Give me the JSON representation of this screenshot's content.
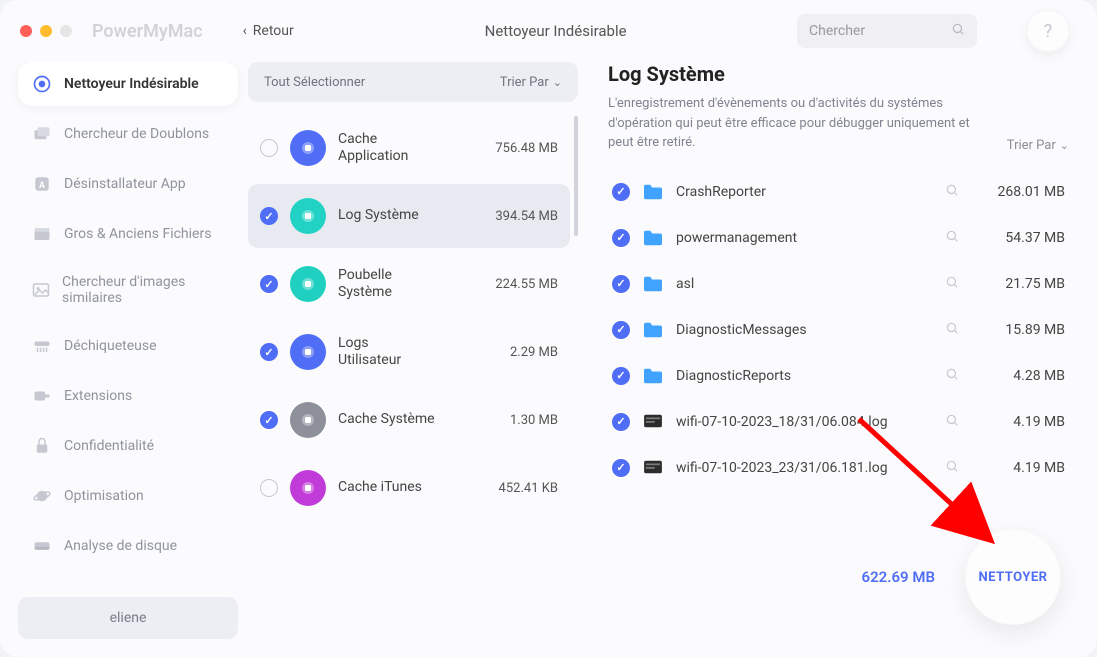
{
  "app_name": "PowerMyMac",
  "back_label": "Retour",
  "top_title": "Nettoyeur Indésirable",
  "search_placeholder": "Chercher",
  "help_label": "?",
  "sidebar": {
    "items": [
      {
        "label": "Nettoyeur Indésirable"
      },
      {
        "label": "Chercheur de Doublons"
      },
      {
        "label": "Désinstallateur App"
      },
      {
        "label": "Gros & Anciens Fichiers"
      },
      {
        "label": "Chercheur d'images similaires"
      },
      {
        "label": "Déchiqueteuse"
      },
      {
        "label": "Extensions"
      },
      {
        "label": "Confidentialité"
      },
      {
        "label": "Optimisation"
      },
      {
        "label": "Analyse de disque"
      }
    ],
    "user": "eliene"
  },
  "middle": {
    "select_all": "Tout Sélectionner",
    "sort_by": "Trier Par",
    "categories": [
      {
        "label": "Cache Application",
        "size": "756.48 MB",
        "checked": false,
        "color": "#4f6df5"
      },
      {
        "label": "Log Système",
        "size": "394.54 MB",
        "checked": true,
        "color": "#22d3c5",
        "selected": true
      },
      {
        "label": "Poubelle Système",
        "size": "224.55 MB",
        "checked": true,
        "color": "#1fcfbf"
      },
      {
        "label": "Logs Utilisateur",
        "size": "2.29 MB",
        "checked": true,
        "color": "#4f6df5"
      },
      {
        "label": "Cache Système",
        "size": "1.30 MB",
        "checked": true,
        "color": "#8d8f9b"
      },
      {
        "label": "Cache iTunes",
        "size": "452.41 KB",
        "checked": false,
        "color": "#c13bd8"
      }
    ]
  },
  "right": {
    "title": "Log Système",
    "description": "L'enregistrement  d'évènements  ou d'activités du systémes d'opération qui peut être efficace pour débugger uniquement et peut être retiré.",
    "sort_by": "Trier Par",
    "files": [
      {
        "name": "CrashReporter",
        "size": "268.01 MB",
        "type": "folder"
      },
      {
        "name": "powermanagement",
        "size": "54.37 MB",
        "type": "folder"
      },
      {
        "name": "asl",
        "size": "21.75 MB",
        "type": "folder"
      },
      {
        "name": "DiagnosticMessages",
        "size": "15.89 MB",
        "type": "folder"
      },
      {
        "name": "DiagnosticReports",
        "size": "4.28 MB",
        "type": "folder"
      },
      {
        "name": "wifi-07-10-2023_18/31/06.084.log",
        "size": "4.19 MB",
        "type": "file"
      },
      {
        "name": "wifi-07-10-2023_23/31/06.181.log",
        "size": "4.19 MB",
        "type": "file"
      }
    ],
    "total": "622.69 MB",
    "clean_label": "NETTOYER"
  }
}
